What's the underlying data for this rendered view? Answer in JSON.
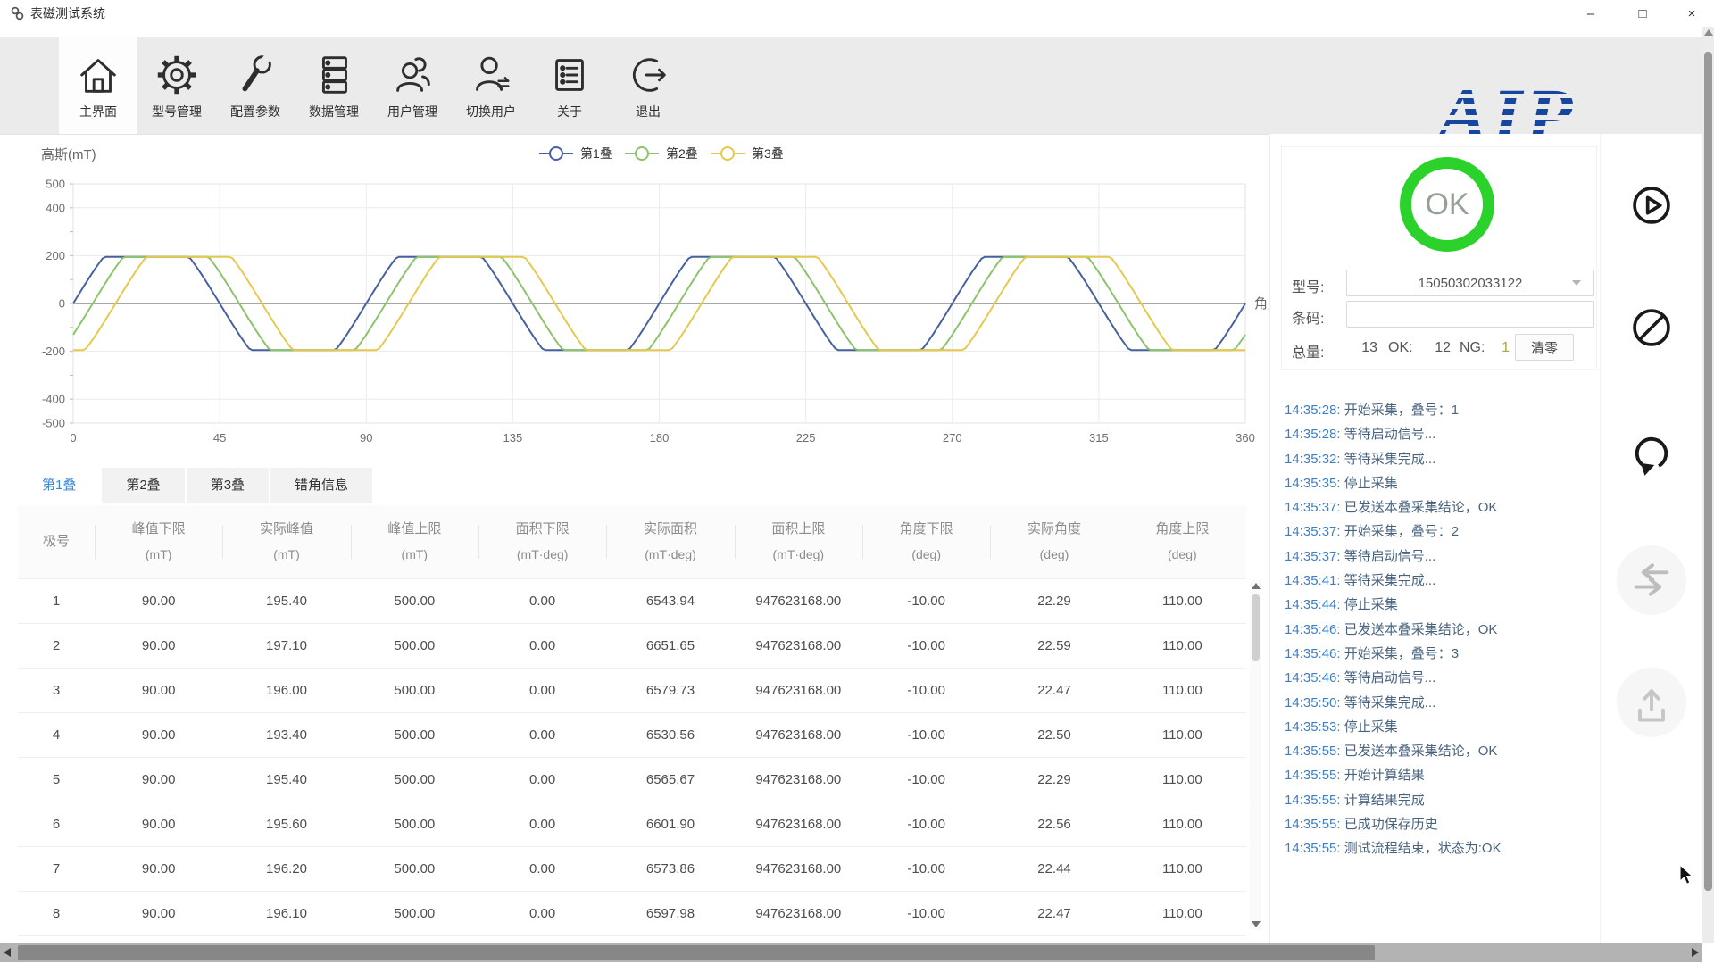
{
  "window": {
    "title": "表磁测试系统",
    "minimize": "–",
    "maximize": "□",
    "close": "×"
  },
  "toolbar": {
    "items": [
      {
        "label": "主界面",
        "icon": "home-icon",
        "active": true
      },
      {
        "label": "型号管理",
        "icon": "gear-icon",
        "active": false
      },
      {
        "label": "配置参数",
        "icon": "wrench-icon",
        "active": false
      },
      {
        "label": "数据管理",
        "icon": "database-icon",
        "active": false
      },
      {
        "label": "用户管理",
        "icon": "users-icon",
        "active": false
      },
      {
        "label": "切换用户",
        "icon": "switch-user-icon",
        "active": false
      },
      {
        "label": "关于",
        "icon": "about-icon",
        "active": false
      },
      {
        "label": "退出",
        "icon": "exit-icon",
        "active": false
      }
    ],
    "logo_text": "AIP",
    "logo_color": "#17469e"
  },
  "chart_data": {
    "type": "line",
    "title": "",
    "ylabel": "高斯(mT)",
    "xlabel": "角度",
    "xlim": [
      0,
      360
    ],
    "ylim": [
      -500,
      500
    ],
    "x_ticks": [
      0,
      45,
      90,
      135,
      180,
      225,
      270,
      315,
      360
    ],
    "y_ticks": [
      500,
      400,
      200,
      0,
      -200,
      -400,
      -500
    ],
    "grid": true,
    "legend_position": "top",
    "waveform_note": "three trapezoidal (clipped-sine) magnet waves, 4 cycles over 0-360 deg, plateaus at about +/-195 mT, each stack phase-shifted",
    "series": [
      {
        "name": "第1叠",
        "color": "#47619e",
        "period_deg": 90,
        "phase_deg": 0,
        "amplitude": 320,
        "clip": 195
      },
      {
        "name": "第2叠",
        "color": "#8cc46c",
        "period_deg": 90,
        "phase_deg": 6,
        "amplitude": 320,
        "clip": 195
      },
      {
        "name": "第3叠",
        "color": "#e5c94d",
        "period_deg": 90,
        "phase_deg": 13,
        "amplitude": 320,
        "clip": 195
      }
    ]
  },
  "tabs": [
    {
      "label": "第1叠",
      "active": true
    },
    {
      "label": "第2叠",
      "active": false
    },
    {
      "label": "第3叠",
      "active": false
    },
    {
      "label": "错角信息",
      "active": false
    }
  ],
  "table": {
    "columns": [
      {
        "title": "极号",
        "unit": ""
      },
      {
        "title": "峰值下限",
        "unit": "(mT)"
      },
      {
        "title": "实际峰值",
        "unit": "(mT)"
      },
      {
        "title": "峰值上限",
        "unit": "(mT)"
      },
      {
        "title": "面积下限",
        "unit": "(mT·deg)"
      },
      {
        "title": "实际面积",
        "unit": "(mT·deg)"
      },
      {
        "title": "面积上限",
        "unit": "(mT·deg)"
      },
      {
        "title": "角度下限",
        "unit": "(deg)"
      },
      {
        "title": "实际角度",
        "unit": "(deg)"
      },
      {
        "title": "角度上限",
        "unit": "(deg)"
      }
    ],
    "rows": [
      [
        "1",
        "90.00",
        "195.40",
        "500.00",
        "0.00",
        "6543.94",
        "947623168.00",
        "-10.00",
        "22.29",
        "110.00"
      ],
      [
        "2",
        "90.00",
        "197.10",
        "500.00",
        "0.00",
        "6651.65",
        "947623168.00",
        "-10.00",
        "22.59",
        "110.00"
      ],
      [
        "3",
        "90.00",
        "196.00",
        "500.00",
        "0.00",
        "6579.73",
        "947623168.00",
        "-10.00",
        "22.47",
        "110.00"
      ],
      [
        "4",
        "90.00",
        "193.40",
        "500.00",
        "0.00",
        "6530.56",
        "947623168.00",
        "-10.00",
        "22.50",
        "110.00"
      ],
      [
        "5",
        "90.00",
        "195.40",
        "500.00",
        "0.00",
        "6565.67",
        "947623168.00",
        "-10.00",
        "22.29",
        "110.00"
      ],
      [
        "6",
        "90.00",
        "195.60",
        "500.00",
        "0.00",
        "6601.90",
        "947623168.00",
        "-10.00",
        "22.56",
        "110.00"
      ],
      [
        "7",
        "90.00",
        "196.20",
        "500.00",
        "0.00",
        "6573.86",
        "947623168.00",
        "-10.00",
        "22.44",
        "110.00"
      ],
      [
        "8",
        "90.00",
        "196.10",
        "500.00",
        "0.00",
        "6597.98",
        "947623168.00",
        "-10.00",
        "22.47",
        "110.00"
      ]
    ]
  },
  "status": {
    "result": "OK",
    "result_color": "#2bd22b",
    "model_label": "型号:",
    "model_value": "15050302033122",
    "barcode_label": "条码:",
    "barcode_value": "",
    "total_label": "总量:",
    "total_value": "13",
    "ok_label": "OK:",
    "ok_value": "12",
    "ng_label": "NG:",
    "ng_value": "1",
    "ng_color": "#a8a83e",
    "clear_button": "清零"
  },
  "log": [
    {
      "time": "14:35:28:",
      "msg": "开始采集，叠号：1"
    },
    {
      "time": "14:35:28:",
      "msg": "等待启动信号..."
    },
    {
      "time": "14:35:32:",
      "msg": "等待采集完成..."
    },
    {
      "time": "14:35:35:",
      "msg": "停止采集"
    },
    {
      "time": "14:35:37:",
      "msg": "已发送本叠采集结论，OK"
    },
    {
      "time": "14:35:37:",
      "msg": "开始采集，叠号：2"
    },
    {
      "time": "14:35:37:",
      "msg": "等待启动信号..."
    },
    {
      "time": "14:35:41:",
      "msg": "等待采集完成..."
    },
    {
      "time": "14:35:44:",
      "msg": "停止采集"
    },
    {
      "time": "14:35:46:",
      "msg": "已发送本叠采集结论，OK"
    },
    {
      "time": "14:35:46:",
      "msg": "开始采集，叠号：3"
    },
    {
      "time": "14:35:46:",
      "msg": "等待启动信号..."
    },
    {
      "time": "14:35:50:",
      "msg": "等待采集完成..."
    },
    {
      "time": "14:35:53:",
      "msg": "停止采集"
    },
    {
      "time": "14:35:55:",
      "msg": "已发送本叠采集结论，OK"
    },
    {
      "time": "14:35:55:",
      "msg": "开始计算结果"
    },
    {
      "time": "14:35:55:",
      "msg": "计算结果完成"
    },
    {
      "time": "14:35:55:",
      "msg": "已成功保存历史"
    },
    {
      "time": "14:35:55:",
      "msg": "测试流程结束，状态为:OK"
    }
  ],
  "side_buttons": [
    {
      "name": "start-button",
      "icon": "play-circle-icon",
      "enabled": true
    },
    {
      "name": "stop-button",
      "icon": "ban-icon",
      "enabled": true
    },
    {
      "name": "retry-button",
      "icon": "rotate-icon",
      "enabled": true
    },
    {
      "name": "transfer-button",
      "icon": "swap-icon",
      "enabled": false
    },
    {
      "name": "upload-button",
      "icon": "upload-icon",
      "enabled": false
    }
  ]
}
